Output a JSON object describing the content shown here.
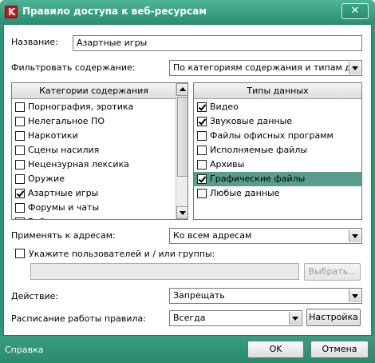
{
  "window": {
    "title": "Правило доступа к веб-ресурсам",
    "app_icon_letter": "K",
    "close_glyph": "✕",
    "accent_color": "#2e9678"
  },
  "form": {
    "name_label": "Название:",
    "name_value": "Азартные игры",
    "filter_label": "Фильтровать содержание:",
    "filter_value": "По категориям содержания и типам данны",
    "apply_label": "Применять к адресам:",
    "apply_value": "Ко всем адресам",
    "users_checkbox_label": "Укажите пользователей и / или группы:",
    "users_value": "",
    "select_button": "Выбрать...",
    "action_label": "Действие:",
    "action_value": "Запрещать",
    "schedule_label": "Расписание работы правила:",
    "schedule_value": "Всегда",
    "settings_button": "Настройка"
  },
  "categories": {
    "header": "Категории содержания",
    "items": [
      {
        "label": "Порнография, эротика",
        "checked": false
      },
      {
        "label": "Нелегальное ПО",
        "checked": false
      },
      {
        "label": "Наркотики",
        "checked": false
      },
      {
        "label": "Сцены насилия",
        "checked": false
      },
      {
        "label": "Нецензурная лексика",
        "checked": false
      },
      {
        "label": "Оружие",
        "checked": false
      },
      {
        "label": "Азартные игры",
        "checked": true
      },
      {
        "label": "Форумы и чаты",
        "checked": false
      },
      {
        "label": "Веб-почта",
        "checked": false
      }
    ]
  },
  "datatypes": {
    "header": "Типы данных",
    "items": [
      {
        "label": "Видео",
        "checked": true,
        "selected": false
      },
      {
        "label": "Звуковые данные",
        "checked": true,
        "selected": false
      },
      {
        "label": "Файлы офисных программ",
        "checked": false,
        "selected": false
      },
      {
        "label": "Исполняемые файлы",
        "checked": false,
        "selected": false
      },
      {
        "label": "Архивы",
        "checked": false,
        "selected": false
      },
      {
        "label": "Графические файлы",
        "checked": true,
        "selected": true
      },
      {
        "label": "Любые данные",
        "checked": false,
        "selected": false
      }
    ]
  },
  "footer": {
    "help_link": "Справка",
    "ok_button": "OK",
    "cancel_button": "Отмена"
  }
}
